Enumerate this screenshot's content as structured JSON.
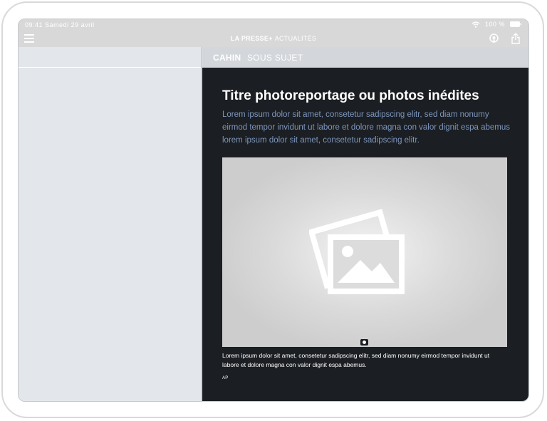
{
  "status_bar": {
    "time": "09:41",
    "date": "Samedi 29 avril",
    "battery": "100 %"
  },
  "nav_bar": {
    "brand": "LA PRESSE+",
    "section": "ACTUALITÉS",
    "icons": [
      "menu-icon",
      "podcast-icon",
      "share-icon"
    ]
  },
  "sub_bar": {
    "cahier": "CAHIN",
    "subject": "SOUS SUJET"
  },
  "article": {
    "title": "Titre photoreportage ou photos inédites",
    "lede": "Lorem ipsum dolor sit amet, consetetur sadipscing elitr, sed diam nonumy eirmod tempor invidunt ut labore et dolore magna con valor dignit espa abemus lorem ipsum dolor sit amet, consetetur sadipscing elitr.",
    "caption": "Lorem ipsum dolor sit amet, consetetur sadipscing elitr, sed diam nonumy eirmod tempor invidunt ut labore et dolore magna con valor dignit espa abemus.",
    "credit": "AP"
  },
  "colors": {
    "content_background": "#1b1e22",
    "lede_text": "#7d96bd",
    "sidebar_background": "#e3e6ea",
    "bars": "#d8d8d8"
  }
}
